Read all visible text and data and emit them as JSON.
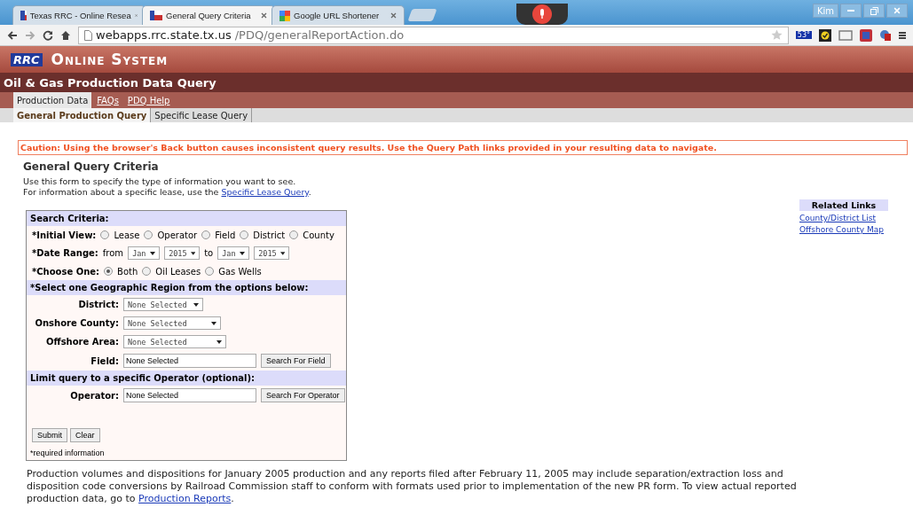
{
  "browser": {
    "tabs": [
      {
        "title": "Texas RRC - Online Resea",
        "selected": false,
        "kind": "rrc"
      },
      {
        "title": "General Query Criteria",
        "selected": true,
        "kind": "rrc"
      },
      {
        "title": "Google URL Shortener",
        "selected": false,
        "kind": "google"
      }
    ],
    "profile": "Kim",
    "url_host": "webapps.rrc.state.tx.us",
    "url_path": "/PDQ/generalReportAction.do",
    "weather_badge": "53°"
  },
  "header": {
    "logo": "RRC",
    "title": "Online System",
    "subtitle": "Oil & Gas Production Data Query"
  },
  "nav": [
    {
      "label": "Production Data",
      "selected": true
    },
    {
      "label": "FAQs",
      "selected": false
    },
    {
      "label": "PDQ Help",
      "selected": false
    }
  ],
  "subnav": [
    {
      "label": "General Production Query",
      "selected": true
    },
    {
      "label": "Specific Lease Query",
      "selected": false
    }
  ],
  "caution": "Caution: Using the browser's Back button causes inconsistent query results. Use the Query Path links provided in your resulting data to navigate.",
  "page_title": "General Query Criteria",
  "intro": "Use this form to specify the type of information you want to see.",
  "intro2": {
    "text": "For information about a specific lease, use the",
    "link": "Specific Lease Query",
    "end": "."
  },
  "form": {
    "heading": "Search Criteria:",
    "initial_view": {
      "label": "*Initial View:",
      "options": [
        {
          "label": "Lease",
          "selected": false
        },
        {
          "label": "Operator",
          "selected": false
        },
        {
          "label": "Field",
          "selected": false
        },
        {
          "label": "District",
          "selected": false
        },
        {
          "label": "County",
          "selected": false
        }
      ]
    },
    "date_range": {
      "label": "*Date Range:",
      "from": "from",
      "to": "to",
      "start_month": "Jan",
      "start_year": "2015",
      "end_month": "Jan",
      "end_year": "2015"
    },
    "choose_one": {
      "label": "*Choose One:",
      "options": [
        {
          "label": "Both",
          "selected": true
        },
        {
          "label": "Oil Leases",
          "selected": false
        },
        {
          "label": "Gas Wells",
          "selected": false
        }
      ]
    },
    "region_heading": "*Select one Geographic Region from the options below:",
    "district": {
      "label": "District:",
      "value": "None Selected"
    },
    "onshore_county": {
      "label": "Onshore County:",
      "value": "None Selected"
    },
    "offshore_area": {
      "label": "Offshore Area:",
      "value": "None Selected"
    },
    "field": {
      "label": "Field:",
      "value": "None Selected",
      "button": "Search For Field"
    },
    "operator_heading": "Limit query to a specific Operator (optional):",
    "operator": {
      "label": "Operator:",
      "value": "None Selected",
      "button": "Search For Operator"
    },
    "buttons": [
      "Submit",
      "Clear"
    ],
    "note": "*required information"
  },
  "related_links": {
    "heading": "Related Links",
    "links": [
      "County/District List",
      "Offshore County Map"
    ]
  },
  "footer": {
    "text": "Production volumes and dispositions for January 2005 production and any reports filed after February 11, 2005 may include separation/extraction loss and disposition code conversions by Railroad Commission staff to conform with formats used prior to implementation of the new PR form. To view actual reported production data, go to",
    "link": "Production Reports",
    "end": "."
  }
}
